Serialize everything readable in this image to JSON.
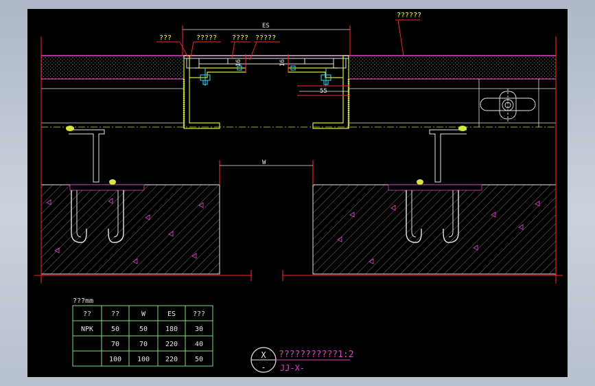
{
  "callouts": {
    "top_right": "??????",
    "cover_left": "???",
    "cover_mid1": "?????",
    "cover_mid2": "????",
    "cover_mid3": "?????"
  },
  "dims": {
    "es": "ES",
    "w": "W",
    "d55": "55",
    "d16a": "16",
    "d16b": "16"
  },
  "table": {
    "unit_label": "???mm",
    "headers": [
      "??",
      "??",
      "W",
      "ES",
      "???"
    ],
    "rows": [
      [
        "NPK",
        "50",
        "50",
        "180",
        "30"
      ],
      [
        "",
        "70",
        "70",
        "220",
        "40"
      ],
      [
        "",
        "100",
        "100",
        "220",
        "50"
      ]
    ]
  },
  "title_block": {
    "symbol_top": "X",
    "symbol_bottom": "-",
    "title": "???????????1:2",
    "code": "JJ-X-"
  },
  "colors": {
    "background": "#000000",
    "outline": "#e8e8e8",
    "steel": "#d7e63a",
    "accent": "#e040c8",
    "red_line": "#ff2a2a",
    "cyan": "#29e0ff"
  }
}
